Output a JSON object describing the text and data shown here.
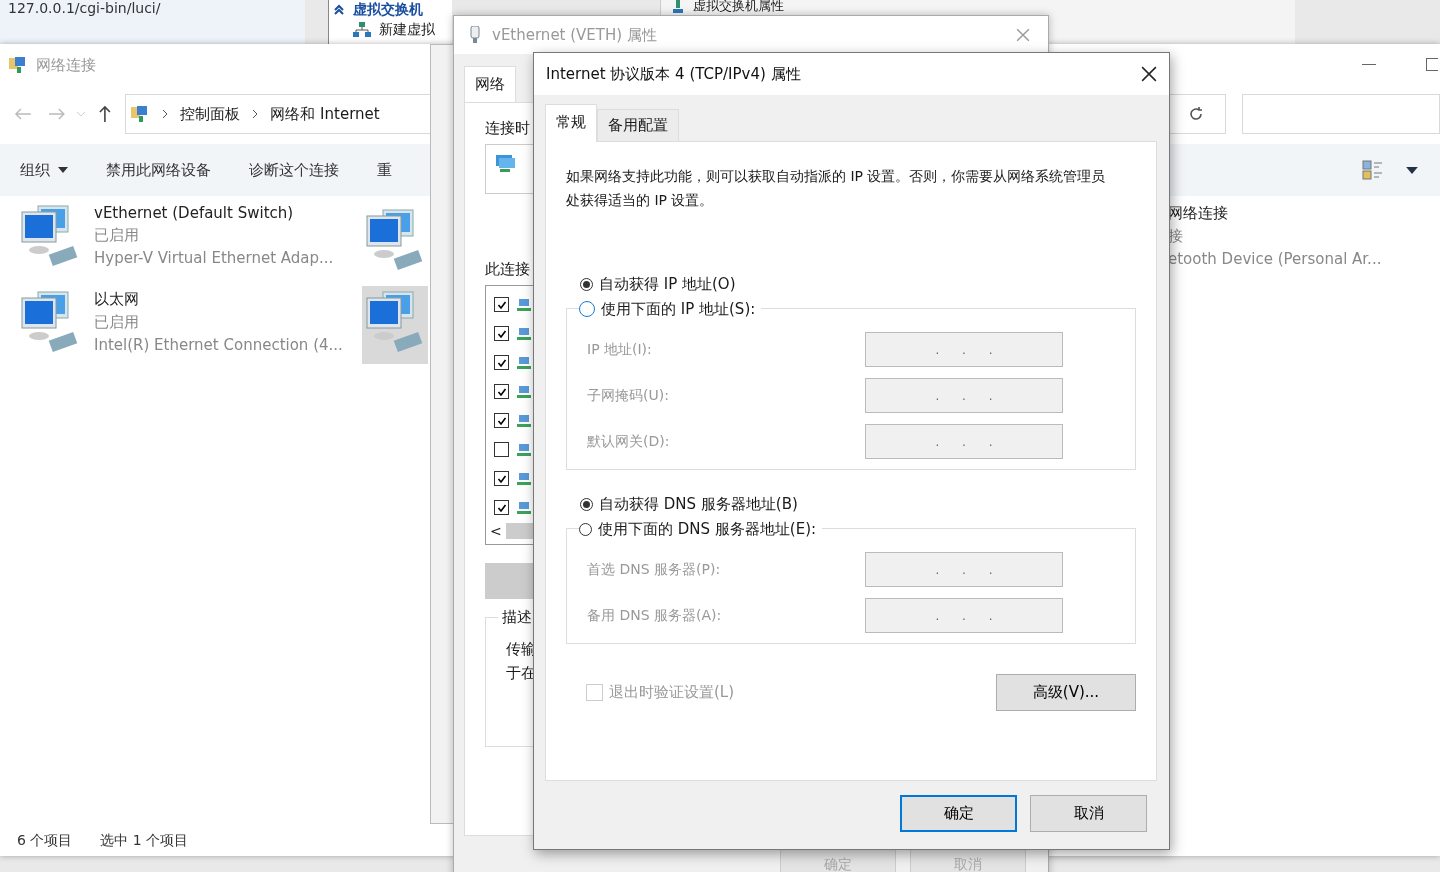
{
  "browser_remnant": {
    "address": "127.0.0.1/cgi-bin/luci/"
  },
  "hyperv_remnant": {
    "section": "虚拟交换机",
    "action": "新建虚拟",
    "dialog_title": "虚拟交换机属性"
  },
  "explorer": {
    "title": "网络连接",
    "breadcrumb": [
      "控制面板",
      "网络和 Internet"
    ],
    "toolbar": [
      {
        "label": "组织",
        "dropdown": true
      },
      {
        "label": "禁用此网络设备",
        "dropdown": false
      },
      {
        "label": "诊断这个连接",
        "dropdown": false
      },
      {
        "label": "重",
        "dropdown": false
      }
    ],
    "connections": [
      {
        "name": "vEthernet (Default Switch)",
        "status": "已启用",
        "device": "Hyper-V Virtual Ethernet Adap..."
      },
      {
        "name": "以太网",
        "status": "已启用",
        "device": "Intel(R) Ethernet Connection (4..."
      }
    ],
    "second_column": [
      {
        "selected": false
      },
      {
        "selected": true
      }
    ],
    "third_column": {
      "name": "网络连接",
      "status": "接",
      "device": "etooth Device (Personal Ar..."
    },
    "status_bar": [
      "6 个项目",
      "选中 1 个项目"
    ]
  },
  "adapter_dialog": {
    "title": "vEthernet (VETH) 属性",
    "tab": "网络",
    "connect_label": "连接时",
    "items_label": "此连接",
    "items": [
      {
        "checked": true
      },
      {
        "checked": true
      },
      {
        "checked": true
      },
      {
        "checked": true
      },
      {
        "checked": true
      },
      {
        "checked": false
      },
      {
        "checked": true
      },
      {
        "checked": true
      }
    ],
    "scroll_left": "<",
    "description_label": "描述",
    "description": [
      "传输",
      "于在"
    ],
    "buttons": [
      "确定",
      "取消"
    ]
  },
  "ipv4_dialog": {
    "title": "Internet 协议版本 4 (TCP/IPv4) 属性",
    "tabs": [
      {
        "label": "常规",
        "selected": true
      },
      {
        "label": "备用配置",
        "selected": false
      }
    ],
    "intro": "如果网络支持此功能，则可以获取自动指派的 IP 设置。否则，你需要从网络系统管理员处获得适当的 IP 设置。",
    "ip_section": {
      "options": [
        {
          "label": "自动获得 IP 地址(O)",
          "selected": true
        },
        {
          "label": "使用下面的 IP 地址(S):",
          "selected": false
        }
      ],
      "fields": [
        {
          "label": "IP 地址(I):",
          "value": ".      .      .",
          "disabled": true
        },
        {
          "label": "子网掩码(U):",
          "value": ".      .      .",
          "disabled": true
        },
        {
          "label": "默认网关(D):",
          "value": ".      .      .",
          "disabled": true
        }
      ]
    },
    "dns_section": {
      "options": [
        {
          "label": "自动获得 DNS 服务器地址(B)",
          "selected": true
        },
        {
          "label": "使用下面的 DNS 服务器地址(E):",
          "selected": false
        }
      ],
      "fields": [
        {
          "label": "首选 DNS 服务器(P):",
          "value": ".      .      .",
          "disabled": true
        },
        {
          "label": "备用 DNS 服务器(A):",
          "value": ".      .      .",
          "disabled": true
        }
      ]
    },
    "validate": {
      "label": "退出时验证设置(L)",
      "checked": false,
      "disabled": true
    },
    "advanced_button": "高级(V)...",
    "buttons": [
      {
        "label": "确定",
        "default": true
      },
      {
        "label": "取消",
        "default": false
      }
    ]
  }
}
